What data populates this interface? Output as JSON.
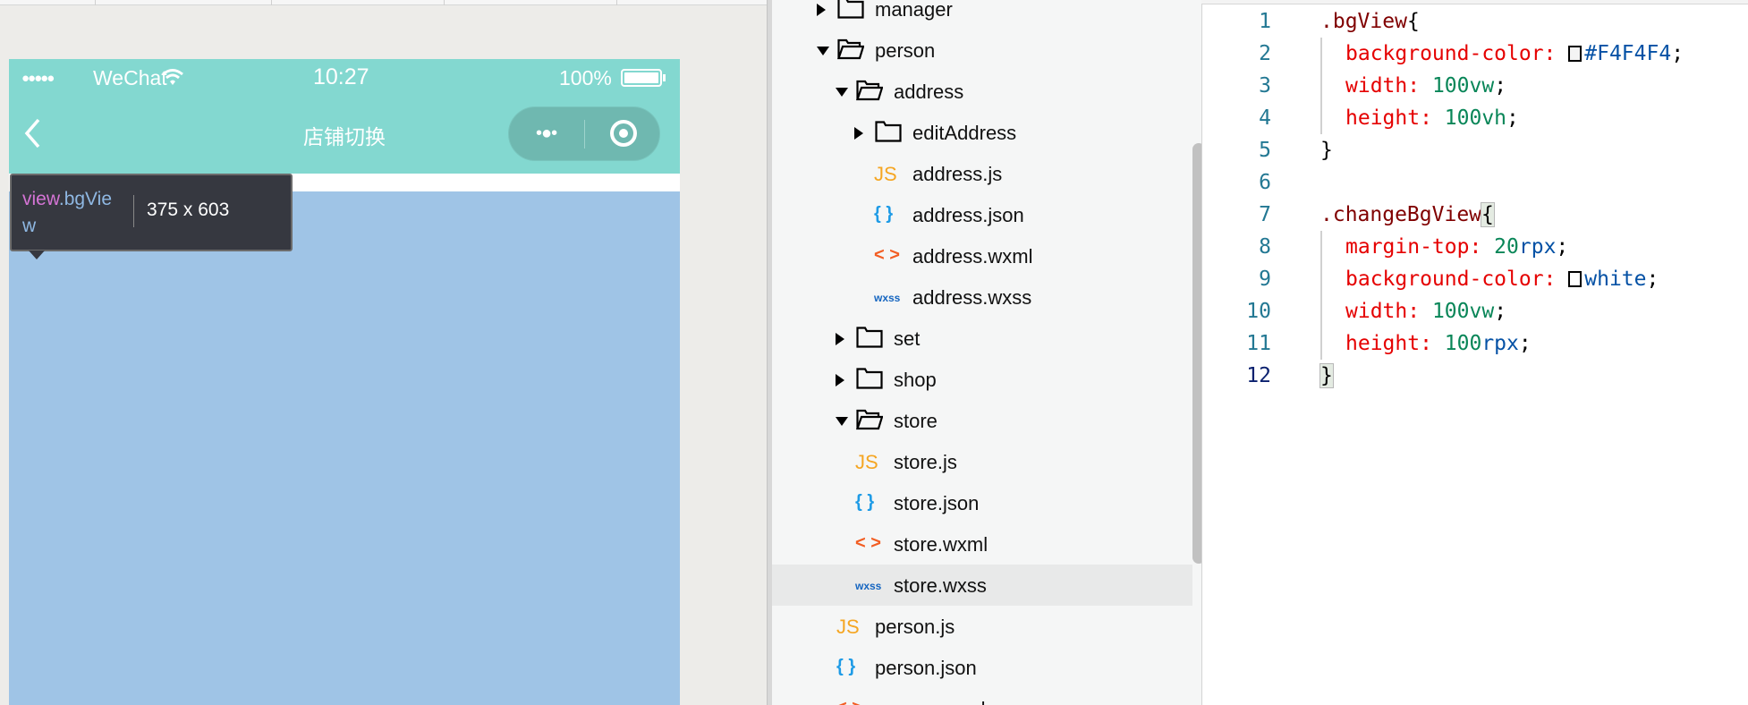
{
  "phone": {
    "carrier": "WeChat",
    "time": "10:27",
    "battery": "100%",
    "nav_title": "店铺切换",
    "content_bg": "#9fc4e6",
    "nav_bg": "#83d8d0"
  },
  "tooltip": {
    "tag": "view",
    "class_part1": ".bgVie",
    "class_part2": "w",
    "size": "375 x 603"
  },
  "tree": {
    "items": [
      {
        "name": "manager",
        "type": "folder",
        "state": "closed",
        "depth": 0
      },
      {
        "name": "person",
        "type": "folder",
        "state": "open",
        "depth": 0
      },
      {
        "name": "address",
        "type": "folder",
        "state": "open",
        "depth": 1
      },
      {
        "name": "editAddress",
        "type": "folder",
        "state": "closed",
        "depth": 2
      },
      {
        "name": "address.js",
        "type": "js",
        "depth": 3
      },
      {
        "name": "address.json",
        "type": "json",
        "depth": 3
      },
      {
        "name": "address.wxml",
        "type": "wxml",
        "depth": 3
      },
      {
        "name": "address.wxss",
        "type": "wxss",
        "depth": 3
      },
      {
        "name": "set",
        "type": "folder",
        "state": "closed",
        "depth": 1
      },
      {
        "name": "shop",
        "type": "folder",
        "state": "closed",
        "depth": 1
      },
      {
        "name": "store",
        "type": "folder",
        "state": "open",
        "depth": 1
      },
      {
        "name": "store.js",
        "type": "js",
        "depth": 2
      },
      {
        "name": "store.json",
        "type": "json",
        "depth": 2
      },
      {
        "name": "store.wxml",
        "type": "wxml",
        "depth": 2
      },
      {
        "name": "store.wxss",
        "type": "wxss",
        "depth": 2,
        "selected": true
      },
      {
        "name": "person.js",
        "type": "js",
        "depth": 1
      },
      {
        "name": "person.json",
        "type": "json",
        "depth": 1
      },
      {
        "name": "person.wxml",
        "type": "wxml",
        "depth": 1
      }
    ],
    "icon_labels": {
      "js": "JS",
      "json": "{ }",
      "wxml": "< >",
      "wxss": "wxss"
    },
    "icon_colors": {
      "js": "#f5a623",
      "json": "#1e9be6",
      "wxml": "#f25d22",
      "wxss": "#1565c0"
    }
  },
  "editor": {
    "current_line": 12,
    "lines": [
      {
        "n": "1",
        "tokens": [
          [
            "t-sel",
            ".bgView"
          ],
          [
            "t-p",
            "{"
          ]
        ]
      },
      {
        "n": "2",
        "indent": true,
        "tokens": [
          [
            "t-prop",
            "background-color: "
          ],
          [
            "swatch",
            "#F4F4F4"
          ],
          [
            "t-val",
            "#F4F4F4"
          ],
          [
            "t-p",
            ";"
          ]
        ]
      },
      {
        "n": "3",
        "indent": true,
        "tokens": [
          [
            "t-prop",
            "width: "
          ],
          [
            "t-num",
            "100vw"
          ],
          [
            "t-p",
            ";"
          ]
        ]
      },
      {
        "n": "4",
        "indent": true,
        "tokens": [
          [
            "t-prop",
            "height: "
          ],
          [
            "t-num",
            "100vh"
          ],
          [
            "t-p",
            ";"
          ]
        ]
      },
      {
        "n": "5",
        "tokens": [
          [
            "t-p",
            "}"
          ]
        ]
      },
      {
        "n": "6",
        "tokens": []
      },
      {
        "n": "7",
        "tokens": [
          [
            "t-sel",
            ".changeBgView"
          ],
          [
            "t-p t-brk",
            "{"
          ]
        ]
      },
      {
        "n": "8",
        "indent": true,
        "tokens": [
          [
            "t-prop",
            "margin-top: "
          ],
          [
            "t-num",
            "20"
          ],
          [
            "t-unit",
            "rpx"
          ],
          [
            "t-p",
            ";"
          ]
        ]
      },
      {
        "n": "9",
        "indent": true,
        "tokens": [
          [
            "t-prop",
            "background-color: "
          ],
          [
            "swatch",
            "#FFFFFF"
          ],
          [
            "t-val",
            "white"
          ],
          [
            "t-p",
            ";"
          ]
        ]
      },
      {
        "n": "10",
        "indent": true,
        "tokens": [
          [
            "t-prop",
            "width: "
          ],
          [
            "t-num",
            "100vw"
          ],
          [
            "t-p",
            ";"
          ]
        ]
      },
      {
        "n": "11",
        "indent": true,
        "tokens": [
          [
            "t-prop",
            "height: "
          ],
          [
            "t-num",
            "100"
          ],
          [
            "t-unit",
            "rpx"
          ],
          [
            "t-p",
            ";"
          ]
        ]
      },
      {
        "n": "12",
        "tokens": [
          [
            "t-p t-brk",
            "}"
          ]
        ]
      }
    ]
  }
}
